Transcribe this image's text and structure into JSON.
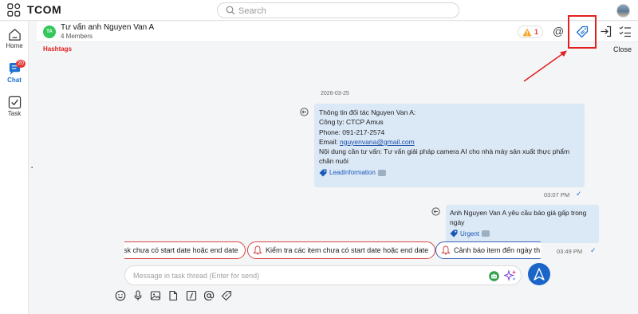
{
  "app": {
    "title": "TCOM"
  },
  "search": {
    "placeholder": "Search"
  },
  "sidebar": {
    "items": [
      {
        "label": "Home",
        "icon": "home-icon"
      },
      {
        "label": "Chat",
        "icon": "chat-icon",
        "badge": "20",
        "active": true
      },
      {
        "label": "Task",
        "icon": "task-checkbox-icon"
      }
    ]
  },
  "chat": {
    "avatar_initials": "TA",
    "name": "Tư vấn anh Nguyen Van A",
    "members": "4 Members",
    "warning_count": "1",
    "mention_symbol": "@"
  },
  "annotations": {
    "hashtags": "Hashtags",
    "close": "Close"
  },
  "messages": [
    {
      "date": "2026-03-25",
      "lines": [
        "Thông tin đối tác Nguyen Van A:",
        "Công ty: CTCP Amus",
        "Phone: 091-217-2574"
      ],
      "email_prefix": "Email: ",
      "email": "nguyenvana@gmail.com",
      "content_line": "Nội dung cần tư vấn: Tư vấn giải pháp camera AI cho nhà máy sản xuất thực phẩm chăn nuôi",
      "tag": "LeadInformation",
      "time": "03:07 PM"
    },
    {
      "text": "Anh Nguyen Van A yêu cầu báo giá gấp trong ngày",
      "tag": "Urgent",
      "time": "03:49 PM"
    }
  ],
  "task_chips": [
    "sk chưa có start date hoặc end date",
    "Kiểm tra các item chưa có start date hoặc end date",
    "Cảnh báo item đến ngày th"
  ],
  "composer": {
    "placeholder": "Message in task thread (Enter for send)"
  },
  "colors": {
    "accent": "#1b65c8",
    "bubble": "#dbe8f6",
    "annotation": "#e02020",
    "badge": "#e53935"
  }
}
